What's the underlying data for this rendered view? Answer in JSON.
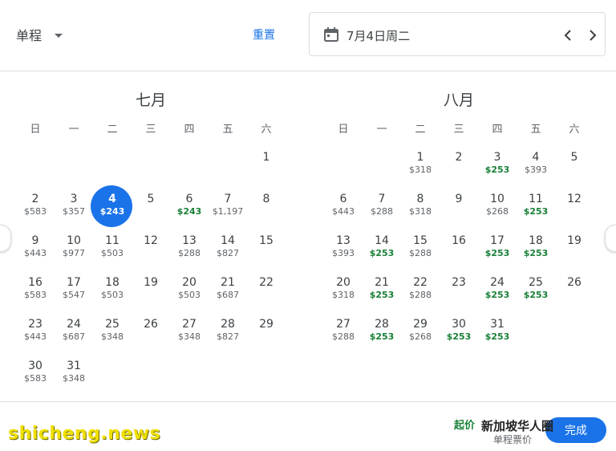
{
  "header": {
    "trip_type": "单程",
    "reset_label": "重置",
    "selected_date": "7月4日周二"
  },
  "months": [
    {
      "title": "七月",
      "weekdays": [
        "日",
        "一",
        "二",
        "三",
        "四",
        "五",
        "六"
      ],
      "lead_blanks": 6,
      "days": [
        {
          "d": "1",
          "p": ""
        },
        {
          "d": "2",
          "p": "$583"
        },
        {
          "d": "3",
          "p": "$357"
        },
        {
          "d": "4",
          "p": "$243",
          "selected": true
        },
        {
          "d": "5",
          "p": ""
        },
        {
          "d": "6",
          "p": "$243",
          "low": true
        },
        {
          "d": "7",
          "p": "$1,197"
        },
        {
          "d": "8",
          "p": ""
        },
        {
          "d": "9",
          "p": "$443"
        },
        {
          "d": "10",
          "p": "$977"
        },
        {
          "d": "11",
          "p": "$503"
        },
        {
          "d": "12",
          "p": ""
        },
        {
          "d": "13",
          "p": "$288"
        },
        {
          "d": "14",
          "p": "$827"
        },
        {
          "d": "15",
          "p": ""
        },
        {
          "d": "16",
          "p": "$583"
        },
        {
          "d": "17",
          "p": "$547"
        },
        {
          "d": "18",
          "p": "$503"
        },
        {
          "d": "19",
          "p": ""
        },
        {
          "d": "20",
          "p": "$503"
        },
        {
          "d": "21",
          "p": "$687"
        },
        {
          "d": "22",
          "p": ""
        },
        {
          "d": "23",
          "p": "$443"
        },
        {
          "d": "24",
          "p": "$687"
        },
        {
          "d": "25",
          "p": "$348"
        },
        {
          "d": "26",
          "p": ""
        },
        {
          "d": "27",
          "p": "$348"
        },
        {
          "d": "28",
          "p": "$827"
        },
        {
          "d": "29",
          "p": ""
        },
        {
          "d": "30",
          "p": "$583"
        },
        {
          "d": "31",
          "p": "$348"
        }
      ]
    },
    {
      "title": "八月",
      "weekdays": [
        "日",
        "一",
        "二",
        "三",
        "四",
        "五",
        "六"
      ],
      "lead_blanks": 2,
      "days": [
        {
          "d": "1",
          "p": "$318"
        },
        {
          "d": "2",
          "p": ""
        },
        {
          "d": "3",
          "p": "$253",
          "low": true
        },
        {
          "d": "4",
          "p": "$393"
        },
        {
          "d": "5",
          "p": ""
        },
        {
          "d": "6",
          "p": "$443"
        },
        {
          "d": "7",
          "p": "$288"
        },
        {
          "d": "8",
          "p": "$318"
        },
        {
          "d": "9",
          "p": ""
        },
        {
          "d": "10",
          "p": "$268"
        },
        {
          "d": "11",
          "p": "$253",
          "low": true
        },
        {
          "d": "12",
          "p": ""
        },
        {
          "d": "13",
          "p": "$393"
        },
        {
          "d": "14",
          "p": "$253",
          "low": true
        },
        {
          "d": "15",
          "p": "$288"
        },
        {
          "d": "16",
          "p": ""
        },
        {
          "d": "17",
          "p": "$253",
          "low": true
        },
        {
          "d": "18",
          "p": "$253",
          "low": true
        },
        {
          "d": "19",
          "p": ""
        },
        {
          "d": "20",
          "p": "$318"
        },
        {
          "d": "21",
          "p": "$253",
          "low": true
        },
        {
          "d": "22",
          "p": "$288"
        },
        {
          "d": "23",
          "p": ""
        },
        {
          "d": "24",
          "p": "$253",
          "low": true
        },
        {
          "d": "25",
          "p": "$253",
          "low": true
        },
        {
          "d": "26",
          "p": ""
        },
        {
          "d": "27",
          "p": "$288"
        },
        {
          "d": "28",
          "p": "$253",
          "low": true
        },
        {
          "d": "29",
          "p": "$268"
        },
        {
          "d": "30",
          "p": "$253",
          "low": true
        },
        {
          "d": "31",
          "p": "$253",
          "low": true
        }
      ]
    }
  ],
  "footer": {
    "starting_price": "起价",
    "oneway_note": "单程票价",
    "done_label": "完成"
  },
  "watermark": {
    "logo_text": "新加坡华人圈",
    "site_text": "shicheng.news"
  },
  "colors": {
    "accent": "#1a73e8",
    "low_price": "#188038"
  }
}
